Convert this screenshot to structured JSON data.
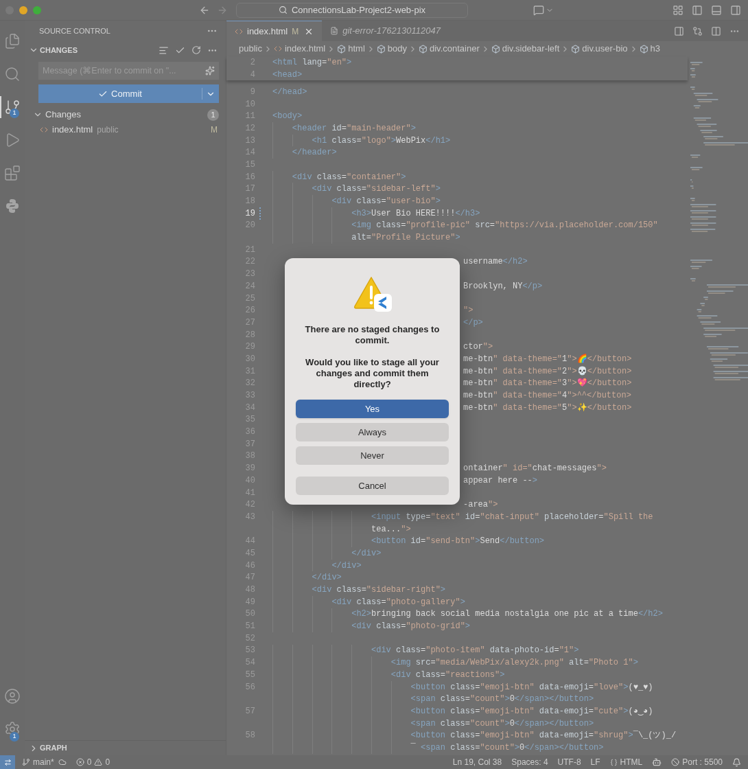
{
  "titlebar": {
    "search": "ConnectionsLab-Project2-web-pix"
  },
  "activity_bar": [
    {
      "kind": "files",
      "selected": false
    },
    {
      "kind": "search",
      "selected": false
    },
    {
      "kind": "source",
      "selected": true,
      "badge": "1"
    },
    {
      "kind": "debug",
      "selected": false
    },
    {
      "kind": "extensions",
      "selected": false
    },
    {
      "kind": "python",
      "selected": false
    }
  ],
  "activity_bottom": [
    {
      "kind": "account"
    },
    {
      "kind": "settings",
      "badge": "1"
    }
  ],
  "sidebar": {
    "title": "SOURCE CONTROL",
    "section": "CHANGES",
    "message_placeholder": "Message (⌘Enter to commit on \"...",
    "commit_button": "Commit",
    "group": {
      "label": "Changes",
      "count": "1",
      "expanded": true,
      "files": [
        {
          "name": "index.html",
          "folder": "public",
          "status": "M"
        }
      ]
    },
    "graph": "GRAPH"
  },
  "tabs": [
    {
      "label": "index.html",
      "status": "M",
      "kind": "html",
      "selected": true
    },
    {
      "label": "git-error-1762130112047",
      "kind": "text",
      "selected": false
    }
  ],
  "breadcrumbs": [
    {
      "label": "public",
      "kind": "folder"
    },
    {
      "label": "index.html",
      "kind": "file"
    },
    {
      "label": "html",
      "kind": "symbol"
    },
    {
      "label": "body",
      "kind": "symbol"
    },
    {
      "label": "div.container",
      "kind": "symbol"
    },
    {
      "label": "div.sidebar-left",
      "kind": "symbol"
    },
    {
      "label": "div.user-bio",
      "kind": "symbol"
    },
    {
      "label": "h3",
      "kind": "symbol"
    }
  ],
  "editor": {
    "sticky": [
      {
        "n": "2",
        "text": "<html lang=\"en\">"
      },
      {
        "n": "4",
        "text": "<head>"
      }
    ],
    "lines": [
      {
        "n": "9",
        "text": "</head>",
        "kind": "plain"
      },
      {
        "n": "10",
        "kind": "plain"
      },
      {
        "n": "11",
        "text": "<body>",
        "kind": "plain"
      },
      {
        "n": "12",
        "text": "    <header id=\"main-header\">",
        "kind": "plain"
      },
      {
        "n": "13",
        "text": "        <h1 class=\"logo\">WebPix</h1>",
        "kind": "plain"
      },
      {
        "n": "14",
        "text": "    </header>",
        "kind": "plain"
      },
      {
        "n": "15",
        "kind": "plain"
      },
      {
        "n": "16",
        "text": "    <div class=\"container\">",
        "kind": "plain"
      },
      {
        "n": "17",
        "text": "        <div class=\"sidebar-left\">",
        "kind": "plain"
      },
      {
        "n": "18",
        "text": "            <div class=\"user-bio\">",
        "kind": "plain"
      },
      {
        "n": "19",
        "text": "                <h3>User Bio HERE!!!!</h3>",
        "kind": "cursor"
      },
      {
        "n": "20",
        "text": "                <img class=\"profile-pic\" src=\"https://via.placeholder.com/150\"",
        "cont": "alt=\"Profile Picture\">",
        "kind": "plain"
      },
      {
        "n": "21",
        "kind": "plain"
      },
      {
        "n": "22",
        "text": "username</h2>",
        "kind": "covered"
      },
      {
        "n": "23",
        "kind": "covered"
      },
      {
        "n": "24",
        "text": "Brooklyn, NY</p>",
        "kind": "covered"
      },
      {
        "n": "25",
        "kind": "covered"
      },
      {
        "n": "26",
        "text": "\">",
        "kind": "covered"
      },
      {
        "n": "27",
        "text": "</p>",
        "kind": "covered"
      },
      {
        "n": "28",
        "kind": "covered"
      },
      {
        "n": "29",
        "text": "ctor\">",
        "kind": "covered"
      },
      {
        "n": "30",
        "text": "me-btn\" data-theme=\"1\">🌈</button>",
        "kind": "covered"
      },
      {
        "n": "31",
        "text": "me-btn\" data-theme=\"2\">💀</button>",
        "kind": "covered"
      },
      {
        "n": "32",
        "text": "me-btn\" data-theme=\"3\">💖</button>",
        "kind": "covered"
      },
      {
        "n": "33",
        "text": "me-btn\" data-theme=\"4\">^^</button>",
        "kind": "covered"
      },
      {
        "n": "34",
        "text": "me-btn\" data-theme=\"5\">✨</button>",
        "kind": "covered"
      },
      {
        "n": "35",
        "kind": "covered"
      },
      {
        "n": "36",
        "kind": "covered"
      },
      {
        "n": "37",
        "kind": "covered"
      },
      {
        "n": "38",
        "kind": "covered"
      },
      {
        "n": "39",
        "text": "ontainer\" id=\"chat-messages\">",
        "kind": "covered"
      },
      {
        "n": "40",
        "text": "appear here -->",
        "kind": "covered"
      },
      {
        "n": "41",
        "kind": "covered"
      },
      {
        "n": "42",
        "text": "-area\">",
        "kind": "covered"
      },
      {
        "n": "43",
        "text": "                    <input type=\"text\" id=\"chat-input\" placeholder=\"Spill the",
        "cont": "tea...\">",
        "kind": "plain"
      },
      {
        "n": "44",
        "text": "                    <button id=\"send-btn\">Send</button>",
        "kind": "plain"
      },
      {
        "n": "45",
        "text": "                </div>",
        "kind": "plain"
      },
      {
        "n": "46",
        "text": "            </div>",
        "kind": "plain"
      },
      {
        "n": "47",
        "text": "        </div>",
        "kind": "plain"
      },
      {
        "n": "48",
        "text": "        <div class=\"sidebar-right\">",
        "kind": "plain"
      },
      {
        "n": "49",
        "text": "            <div class=\"photo-gallery\">",
        "kind": "plain"
      },
      {
        "n": "50",
        "text": "                <h2>bringing back social media nostalgia one pic at a time</h2>",
        "kind": "plain"
      },
      {
        "n": "51",
        "text": "                <div class=\"photo-grid\">",
        "kind": "plain"
      },
      {
        "n": "52",
        "kind": "plain"
      },
      {
        "n": "53",
        "text": "                    <div class=\"photo-item\" data-photo-id=\"1\">",
        "kind": "plain"
      },
      {
        "n": "54",
        "text": "                        <img src=\"media/WebPix/alexy2k.png\" alt=\"Photo 1\">",
        "kind": "plain"
      },
      {
        "n": "55",
        "text": "                        <div class=\"reactions\">",
        "kind": "plain"
      },
      {
        "n": "56",
        "text": "                            <button class=\"emoji-btn\" data-emoji=\"love\">(♥_♥)",
        "cont": "<span class=\"count\">0</span></button>",
        "kind": "plain"
      },
      {
        "n": "57",
        "text": "                            <button class=\"emoji-btn\" data-emoji=\"cute\">(◕‿◕)",
        "cont": "<span class=\"count\">0</span></button>",
        "kind": "plain"
      },
      {
        "n": "58",
        "text": "                            <button class=\"emoji-btn\" data-emoji=\"shrug\">¯\\_(ツ)_/",
        "cont": "¯ <span class=\"count\">0</span></button>",
        "kind": "plain"
      }
    ]
  },
  "dialog": {
    "title": "There are no staged changes to commit.",
    "message": "Would you like to stage all your changes and commit them directly?",
    "buttons": [
      {
        "label": "Yes",
        "kind": "primary"
      },
      {
        "label": "Always",
        "kind": "secondary"
      },
      {
        "label": "Never",
        "kind": "secondary"
      },
      {
        "label": "Cancel",
        "kind": "cancel"
      }
    ]
  },
  "status_bar": {
    "branch": "main*",
    "errors": "0",
    "warnings": "0",
    "items": [
      "Ln 19, Col 38",
      "Spaces: 4",
      "UTF-8",
      "LF"
    ],
    "language": "HTML",
    "port": "Port : 5500"
  }
}
